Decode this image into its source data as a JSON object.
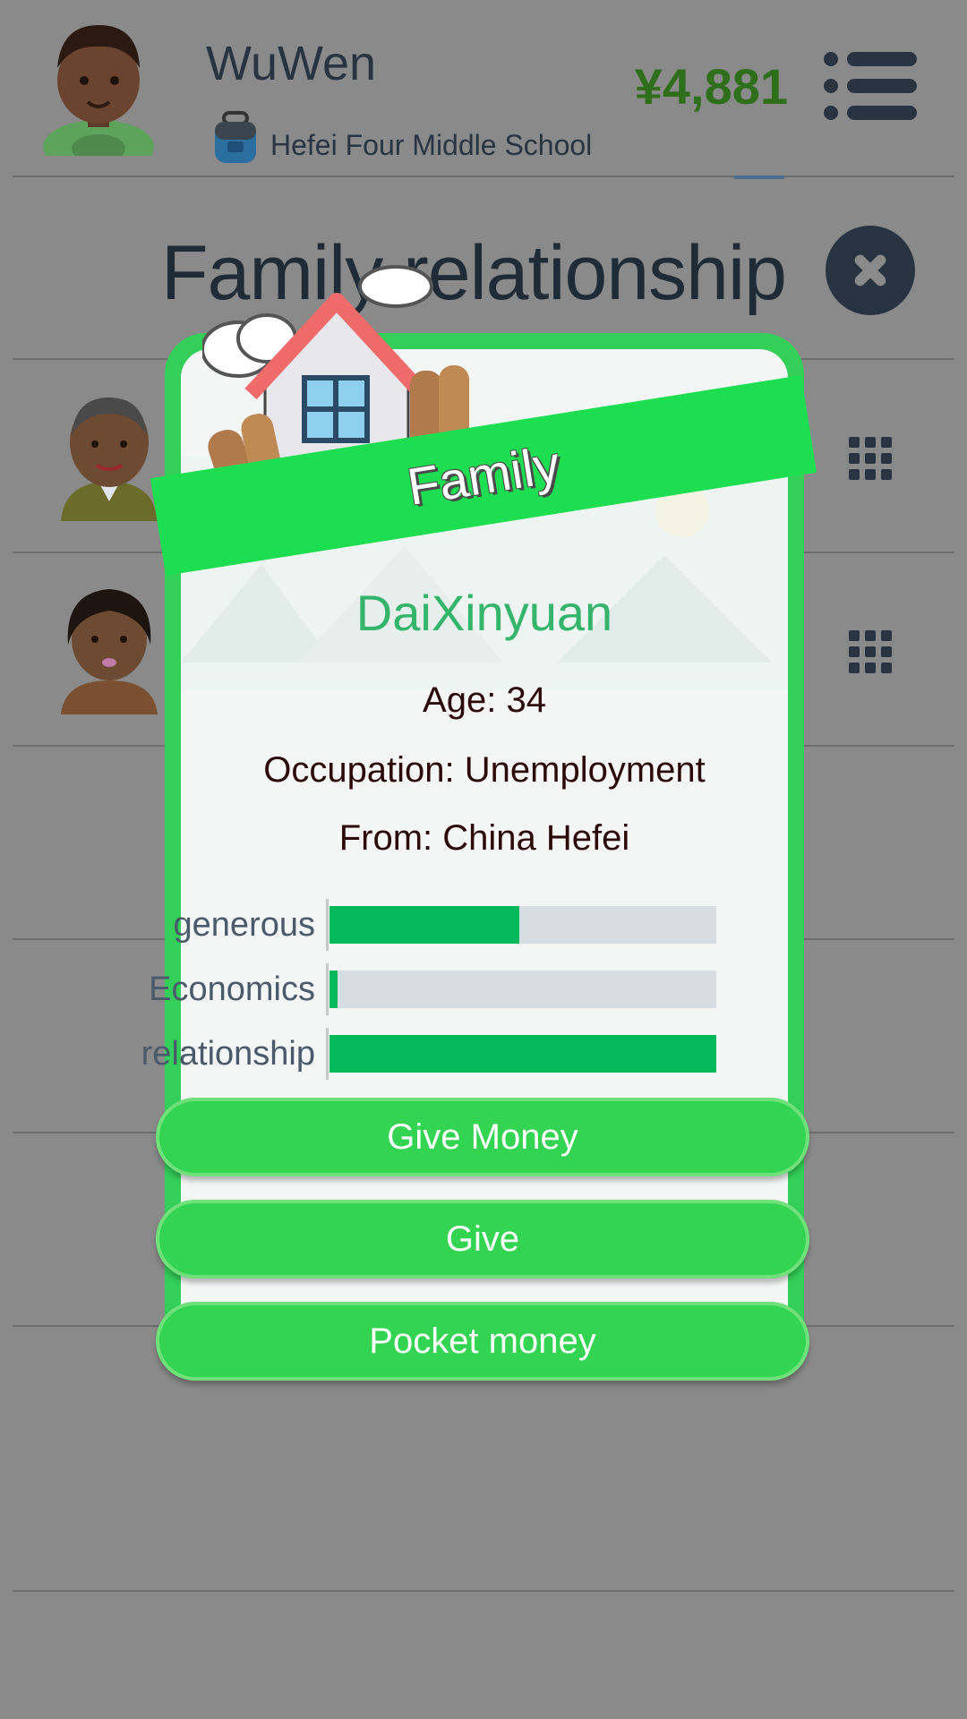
{
  "header": {
    "player_name": "WuWen",
    "school_icon": "school-bag-icon",
    "school_name": "Hefei Four Middle School",
    "money": "¥4,881",
    "menu_icon": "menu-list-icon"
  },
  "page": {
    "title": "Family relationship",
    "close_icon": "close-icon",
    "grid_icon": "grid-dots-icon"
  },
  "modal": {
    "banner": "Family",
    "name": "DaiXinyuan",
    "age": "Age: 34",
    "occupation": "Occupation: Unemployment",
    "from": "From: China Hefei",
    "stats": [
      {
        "label": "generous",
        "value": 0.49
      },
      {
        "label": "Economics",
        "value": 0.02
      },
      {
        "label": "relationship",
        "value": 1.0
      }
    ],
    "buttons": [
      "Give Money",
      "Give",
      "Pocket money"
    ]
  },
  "colors": {
    "card_border": "#33cf58",
    "ribbon": "#1cde50",
    "stat_fill": "#04b95a",
    "name": "#35b56b",
    "money": "#2f6f1c"
  }
}
